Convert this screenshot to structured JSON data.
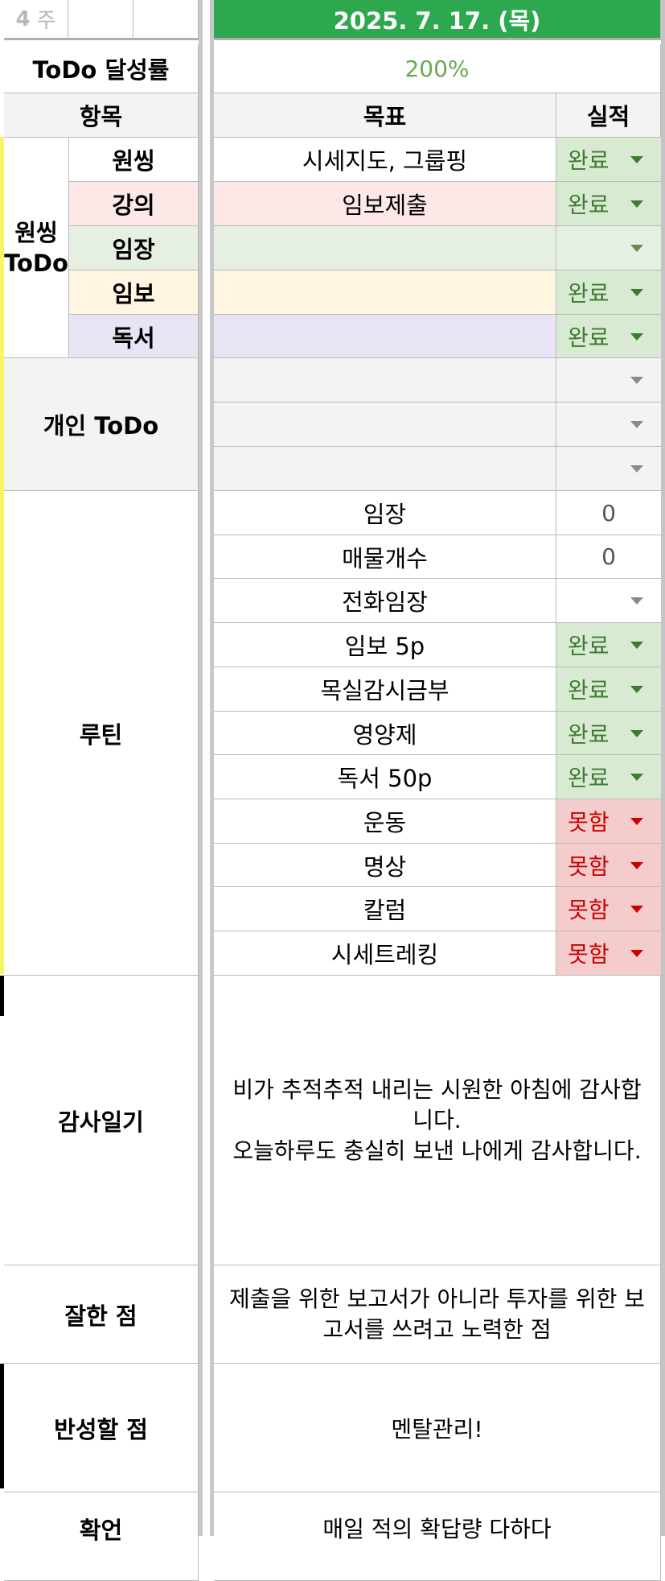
{
  "header": {
    "week_num": "4",
    "week_label": "주",
    "date": "2025. 7. 17. (목)"
  },
  "colors": {
    "green_header": "#2ea84e",
    "done_bg": "#d9ead3",
    "done_text": "#3e7a31",
    "fail_bg": "#f4cccc",
    "fail_text": "#cc0000",
    "lecture_bg": "#fce8e6",
    "imjang_bg": "#e6f0e2",
    "imbo_bg": "#fff5e0",
    "reading_bg": "#e8e4f5"
  },
  "rate": {
    "label": "ToDo 달성률",
    "value": "200%"
  },
  "col_headers": {
    "item": "항목",
    "goal": "목표",
    "result": "실적"
  },
  "wonssing": {
    "group_label": "원씽\nToDo",
    "rows": [
      {
        "sub": "원씽",
        "goal": "시세지도, 그룹핑",
        "status": "완료"
      },
      {
        "sub": "강의",
        "goal": "임보제출",
        "status": "완료"
      },
      {
        "sub": "임장",
        "goal": "",
        "status": ""
      },
      {
        "sub": "임보",
        "goal": "",
        "status": "완료"
      },
      {
        "sub": "독서",
        "goal": "",
        "status": "완료"
      }
    ]
  },
  "personal": {
    "label": "개인 ToDo",
    "rows": [
      {
        "goal": "",
        "status": ""
      },
      {
        "goal": "",
        "status": ""
      },
      {
        "goal": "",
        "status": ""
      }
    ]
  },
  "routine": {
    "label": "루틴",
    "rows": [
      {
        "goal": "임장",
        "status": "0",
        "kind": "number"
      },
      {
        "goal": "매물개수",
        "status": "0",
        "kind": "number"
      },
      {
        "goal": "전화임장",
        "status": "",
        "kind": "empty"
      },
      {
        "goal": "임보 5p",
        "status": "완료",
        "kind": "done"
      },
      {
        "goal": "목실감시금부",
        "status": "완료",
        "kind": "done"
      },
      {
        "goal": "영양제",
        "status": "완료",
        "kind": "done"
      },
      {
        "goal": "독서 50p",
        "status": "완료",
        "kind": "done"
      },
      {
        "goal": "운동",
        "status": "못함",
        "kind": "fail"
      },
      {
        "goal": "명상",
        "status": "못함",
        "kind": "fail"
      },
      {
        "goal": "칼럼",
        "status": "못함",
        "kind": "fail"
      },
      {
        "goal": "시세트레킹",
        "status": "못함",
        "kind": "fail"
      }
    ]
  },
  "gratitude": {
    "label": "감사일기",
    "text": "비가 추적추적 내리는 시원한 아침에 감사합니다.\n오늘하루도 충실히 보낸 나에게 감사합니다."
  },
  "good": {
    "label": "잘한 점",
    "text": "제출을 위한 보고서가 아니라 투자를 위한 보고서를 쓰려고 노력한 점"
  },
  "reflect": {
    "label": "반성할 점",
    "text": "멘탈관리!"
  },
  "affirm": {
    "label": "확언",
    "text": "매일 적의 확답량 다하다"
  }
}
